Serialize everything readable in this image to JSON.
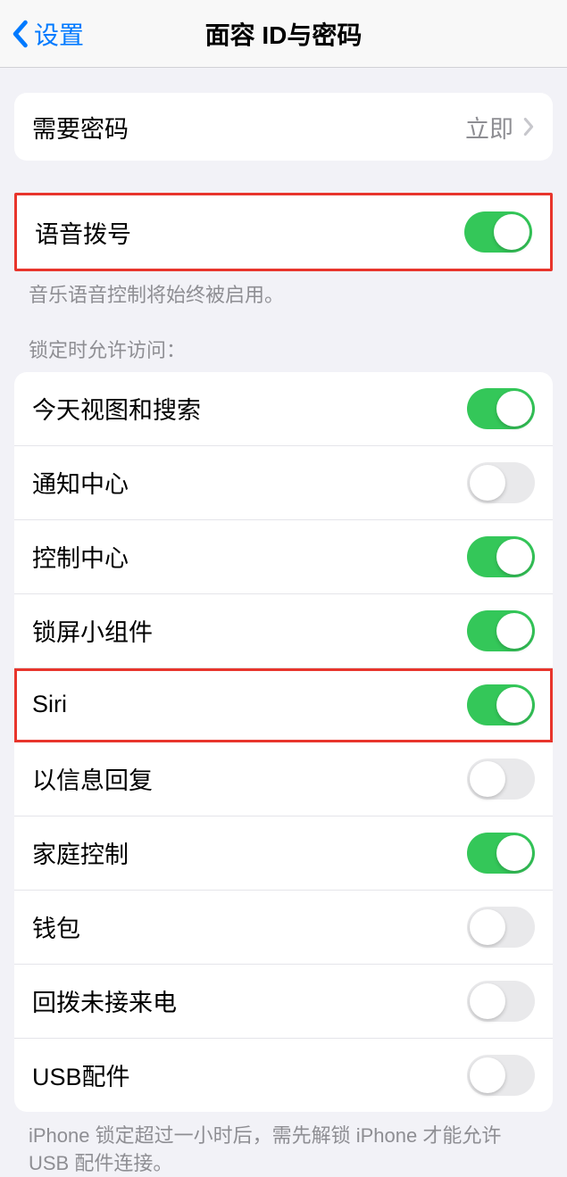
{
  "nav": {
    "back_label": "设置",
    "title": "面容 ID与密码"
  },
  "passcode_row": {
    "label": "需要密码",
    "value": "立即"
  },
  "voice_dial": {
    "label": "语音拨号",
    "on": true,
    "footer": "音乐语音控制将始终被启用。"
  },
  "lock_access": {
    "header": "锁定时允许访问：",
    "items": [
      {
        "label": "今天视图和搜索",
        "on": true
      },
      {
        "label": "通知中心",
        "on": false
      },
      {
        "label": "控制中心",
        "on": true
      },
      {
        "label": "锁屏小组件",
        "on": true
      },
      {
        "label": "Siri",
        "on": true,
        "highlighted": true
      },
      {
        "label": "以信息回复",
        "on": false
      },
      {
        "label": "家庭控制",
        "on": true
      },
      {
        "label": "钱包",
        "on": false
      },
      {
        "label": "回拨未接来电",
        "on": false
      },
      {
        "label": "USB配件",
        "on": false
      }
    ],
    "footer": "iPhone 锁定超过一小时后，需先解锁 iPhone 才能允许USB 配件连接。"
  }
}
